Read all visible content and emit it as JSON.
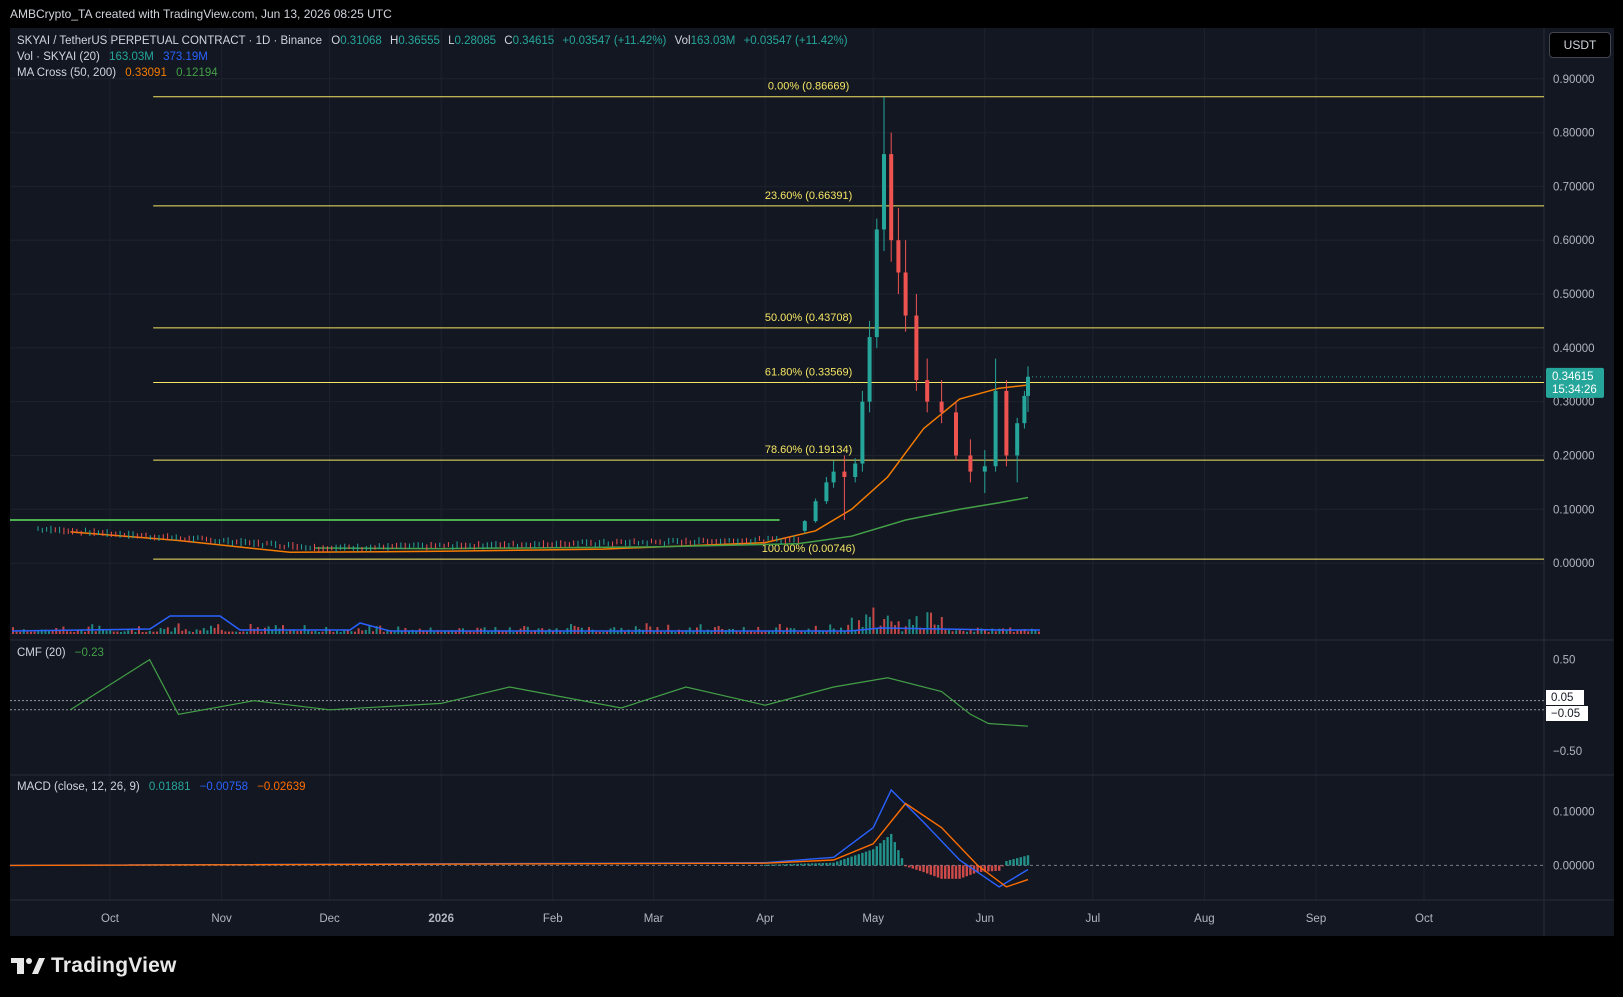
{
  "header": {
    "credit": "AMBCrypto_TA created with TradingView.com, Jun 13, 2026 08:25 UTC"
  },
  "currency_button": "USDT",
  "legend": {
    "title": "SKYAI / TetherUS PERPETUAL CONTRACT · 1D · Binance",
    "o_lbl": "O",
    "o_val": "0.31068",
    "h_lbl": "H",
    "h_val": "0.36555",
    "l_lbl": "L",
    "l_val": "0.28085",
    "c_lbl": "C",
    "c_val": "0.34615",
    "chg": "+0.03547 (+11.42%)",
    "vol_lbl": "Vol",
    "vol_val": "163.03M",
    "vol_chg": "+0.03547 (+11.42%)",
    "vol_ind_name": "Vol · SKYAI (20)",
    "vol_ind_v1": "163.03M",
    "vol_ind_v2": "373.19M",
    "ma_name": "MA Cross (50, 200)",
    "ma_v1": "0.33091",
    "ma_v2": "0.12194",
    "cmf_name": "CMF (20)",
    "cmf_val": "−0.23",
    "macd_name": "MACD (close, 12, 26, 9)",
    "macd_v1": "0.01881",
    "macd_v2": "−0.00758",
    "macd_v3": "−0.02639"
  },
  "price_badge": {
    "price": "0.34615",
    "countdown": "15:34:26"
  },
  "cmf_badges": [
    "0.05",
    "−0.05"
  ],
  "brand": "TradingView",
  "colors": {
    "up": "#26a69a",
    "down": "#ef5350",
    "fib": "#f5e663",
    "ma50": "#f57c00",
    "ma200": "#43a047",
    "cmf": "#43a047",
    "macd": "#2962ff",
    "signal": "#ff6d00",
    "volma": "#2962ff"
  },
  "chart_data": [
    {
      "type": "candlestick",
      "title": "SKYAI / TetherUS PERPETUAL CONTRACT · 1D · Binance",
      "x_ticks": [
        "Oct",
        "Nov",
        "Dec",
        "2026",
        "Feb",
        "Mar",
        "Apr",
        "May",
        "Jun",
        "Jul",
        "Aug",
        "Sep",
        "Oct"
      ],
      "y_ticks": [
        "0.90000",
        "0.80000",
        "0.70000",
        "0.60000",
        "0.50000",
        "0.40000",
        "0.30000",
        "0.20000",
        "0.10000",
        "0.00000"
      ],
      "ylim": [
        -0.05,
        0.92
      ],
      "last": {
        "open": 0.31068,
        "high": 0.36555,
        "low": 0.28085,
        "close": 0.34615
      },
      "fib_levels": [
        {
          "label": "0.00% (0.86669)",
          "value": 0.86669
        },
        {
          "label": "23.60% (0.66391)",
          "value": 0.66391
        },
        {
          "label": "50.00% (0.43708)",
          "value": 0.43708
        },
        {
          "label": "61.80% (0.33569)",
          "value": 0.33569
        },
        {
          "label": "78.60% (0.19134)",
          "value": 0.19134
        },
        {
          "label": "100.00% (0.00746)",
          "value": 0.00746
        }
      ],
      "horizontal_line": 0.08,
      "series": [
        {
          "name": "MA 50",
          "points": [
            [
              "2025-09-20",
              0.058
            ],
            [
              "2025-10-20",
              0.042
            ],
            [
              "2025-11-20",
              0.02
            ],
            [
              "2026-01-01",
              0.022
            ],
            [
              "2026-02-15",
              0.026
            ],
            [
              "2026-04-01",
              0.038
            ],
            [
              "2026-04-15",
              0.06
            ],
            [
              "2026-04-25",
              0.1
            ],
            [
              "2026-05-05",
              0.16
            ],
            [
              "2026-05-15",
              0.25
            ],
            [
              "2026-05-25",
              0.305
            ],
            [
              "2026-06-05",
              0.325
            ],
            [
              "2026-06-13",
              0.33091
            ]
          ]
        },
        {
          "name": "MA 200",
          "points": [
            [
              "2025-11-27",
              0.028
            ],
            [
              "2026-01-01",
              0.027
            ],
            [
              "2026-03-01",
              0.03
            ],
            [
              "2026-04-10",
              0.036
            ],
            [
              "2026-04-25",
              0.05
            ],
            [
              "2026-05-10",
              0.08
            ],
            [
              "2026-05-25",
              0.1
            ],
            [
              "2026-06-05",
              0.112
            ],
            [
              "2026-06-13",
              0.12194
            ]
          ]
        }
      ],
      "candles": [
        [
          "2026-04-12",
          0.06,
          0.08,
          0.055,
          0.078
        ],
        [
          "2026-04-15",
          0.078,
          0.12,
          0.075,
          0.115
        ],
        [
          "2026-04-18",
          0.115,
          0.16,
          0.11,
          0.15
        ],
        [
          "2026-04-20",
          0.15,
          0.19,
          0.14,
          0.17
        ],
        [
          "2026-04-23",
          0.17,
          0.2,
          0.08,
          0.16
        ],
        [
          "2026-04-26",
          0.16,
          0.195,
          0.15,
          0.185
        ],
        [
          "2026-04-28",
          0.185,
          0.32,
          0.17,
          0.3
        ],
        [
          "2026-04-30",
          0.3,
          0.45,
          0.28,
          0.42
        ],
        [
          "2026-05-02",
          0.42,
          0.64,
          0.4,
          0.62
        ],
        [
          "2026-05-04",
          0.62,
          0.866,
          0.58,
          0.76
        ],
        [
          "2026-05-06",
          0.76,
          0.8,
          0.56,
          0.6
        ],
        [
          "2026-05-08",
          0.6,
          0.66,
          0.5,
          0.54
        ],
        [
          "2026-05-10",
          0.54,
          0.6,
          0.43,
          0.46
        ],
        [
          "2026-05-13",
          0.46,
          0.5,
          0.32,
          0.34
        ],
        [
          "2026-05-16",
          0.34,
          0.38,
          0.28,
          0.3
        ],
        [
          "2026-05-20",
          0.3,
          0.34,
          0.26,
          0.28
        ],
        [
          "2026-05-24",
          0.28,
          0.3,
          0.19,
          0.2
        ],
        [
          "2026-05-28",
          0.2,
          0.23,
          0.15,
          0.17
        ],
        [
          "2026-06-01",
          0.17,
          0.21,
          0.13,
          0.18
        ],
        [
          "2026-06-04",
          0.18,
          0.38,
          0.17,
          0.32
        ],
        [
          "2026-06-07",
          0.32,
          0.34,
          0.18,
          0.2
        ],
        [
          "2026-06-10",
          0.2,
          0.27,
          0.15,
          0.26
        ],
        [
          "2026-06-12",
          0.26,
          0.32,
          0.25,
          0.31068
        ],
        [
          "2026-06-13",
          0.31068,
          0.36555,
          0.28085,
          0.34615
        ]
      ]
    },
    {
      "type": "line",
      "title": "CMF (20)",
      "y_ticks": [
        "0.50",
        "−0.50"
      ],
      "ylim": [
        -0.6,
        0.55
      ],
      "levels": [
        0.05,
        -0.05
      ],
      "series": [
        {
          "name": "CMF (20)",
          "points": [
            [
              "2025-09-20",
              -0.05
            ],
            [
              "2025-10-12",
              0.5
            ],
            [
              "2025-10-20",
              -0.1
            ],
            [
              "2025-11-10",
              0.05
            ],
            [
              "2025-12-01",
              -0.05
            ],
            [
              "2026-01-01",
              0.02
            ],
            [
              "2026-01-20",
              0.2
            ],
            [
              "2026-02-20",
              -0.03
            ],
            [
              "2026-03-10",
              0.2
            ],
            [
              "2026-04-01",
              0.0
            ],
            [
              "2026-04-20",
              0.2
            ],
            [
              "2026-05-05",
              0.3
            ],
            [
              "2026-05-20",
              0.15
            ],
            [
              "2026-05-28",
              -0.1
            ],
            [
              "2026-06-02",
              -0.2
            ],
            [
              "2026-06-13",
              -0.23
            ]
          ]
        }
      ]
    },
    {
      "type": "line",
      "title": "MACD (close, 12, 26, 9)",
      "y_ticks": [
        "0.10000",
        "0.00000"
      ],
      "ylim": [
        -0.055,
        0.14
      ],
      "series": [
        {
          "name": "MACD",
          "points": [
            [
              "2026-04-01",
              0.005
            ],
            [
              "2026-04-20",
              0.015
            ],
            [
              "2026-05-01",
              0.07
            ],
            [
              "2026-05-06",
              0.14
            ],
            [
              "2026-05-15",
              0.08
            ],
            [
              "2026-05-25",
              0.01
            ],
            [
              "2026-06-05",
              -0.04
            ],
            [
              "2026-06-13",
              -0.00758
            ]
          ]
        },
        {
          "name": "Signal",
          "points": [
            [
              "2026-04-01",
              0.004
            ],
            [
              "2026-04-20",
              0.01
            ],
            [
              "2026-05-01",
              0.04
            ],
            [
              "2026-05-10",
              0.115
            ],
            [
              "2026-05-20",
              0.07
            ],
            [
              "2026-05-30",
              0.0
            ],
            [
              "2026-06-07",
              -0.04
            ],
            [
              "2026-06-13",
              -0.02639
            ]
          ]
        }
      ],
      "histogram_last": 0.01881
    }
  ]
}
